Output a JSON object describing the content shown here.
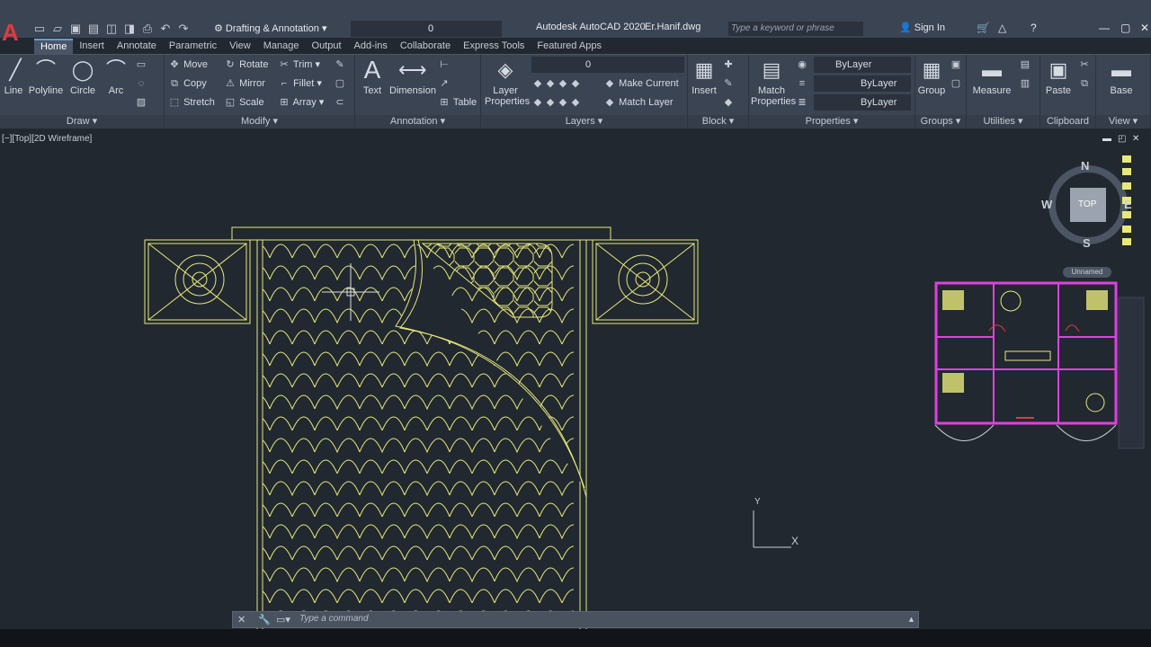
{
  "app": {
    "logo": "A",
    "title": "Autodesk AutoCAD 2020",
    "file": "Er.Hanif.dwg",
    "workspace": "Drafting & Annotation",
    "layer_current": "0",
    "search_placeholder": "Type a keyword or phrase",
    "sign_in": "Sign In"
  },
  "tabs": [
    "Home",
    "Insert",
    "Annotate",
    "Parametric",
    "View",
    "Manage",
    "Output",
    "Add-ins",
    "Collaborate",
    "Express Tools",
    "Featured Apps"
  ],
  "ribbon": {
    "draw": {
      "title": "Draw",
      "line": "Line",
      "polyline": "Polyline",
      "circle": "Circle",
      "arc": "Arc"
    },
    "modify": {
      "title": "Modify",
      "move": "Move",
      "rotate": "Rotate",
      "trim": "Trim",
      "copy": "Copy",
      "mirror": "Mirror",
      "fillet": "Fillet",
      "stretch": "Stretch",
      "scale": "Scale",
      "array": "Array"
    },
    "annotation": {
      "title": "Annotation",
      "text": "Text",
      "dimension": "Dimension",
      "table": "Table"
    },
    "layers": {
      "title": "Layers",
      "layer_properties": "Layer Properties",
      "layer_value": "0",
      "make_current": "Make Current",
      "match_layer": "Match Layer"
    },
    "block": {
      "title": "Block",
      "insert": "Insert"
    },
    "properties": {
      "title": "Properties",
      "match_properties": "Match Properties",
      "color": "ByLayer",
      "linetype": "ByLayer",
      "lineweight": "ByLayer"
    },
    "groups": {
      "title": "Groups",
      "group": "Group"
    },
    "utilities": {
      "title": "Utilities",
      "measure": "Measure"
    },
    "clipboard": {
      "title": "Clipboard",
      "paste": "Paste"
    },
    "view": {
      "title": "View",
      "base": "Base"
    }
  },
  "viewport": {
    "label": "[−][Top][2D Wireframe]",
    "viewcube": {
      "face": "TOP",
      "north": "N",
      "south": "S",
      "west": "W",
      "east": "E"
    },
    "ucs_x": "X",
    "ucs_y": "Y",
    "ucs_name": "Unnamed"
  },
  "command": {
    "placeholder": "Type a command"
  },
  "colors": {
    "drawing": "#e8e87a",
    "walls": "#e040e0",
    "accent_red": "#e03a3e"
  }
}
